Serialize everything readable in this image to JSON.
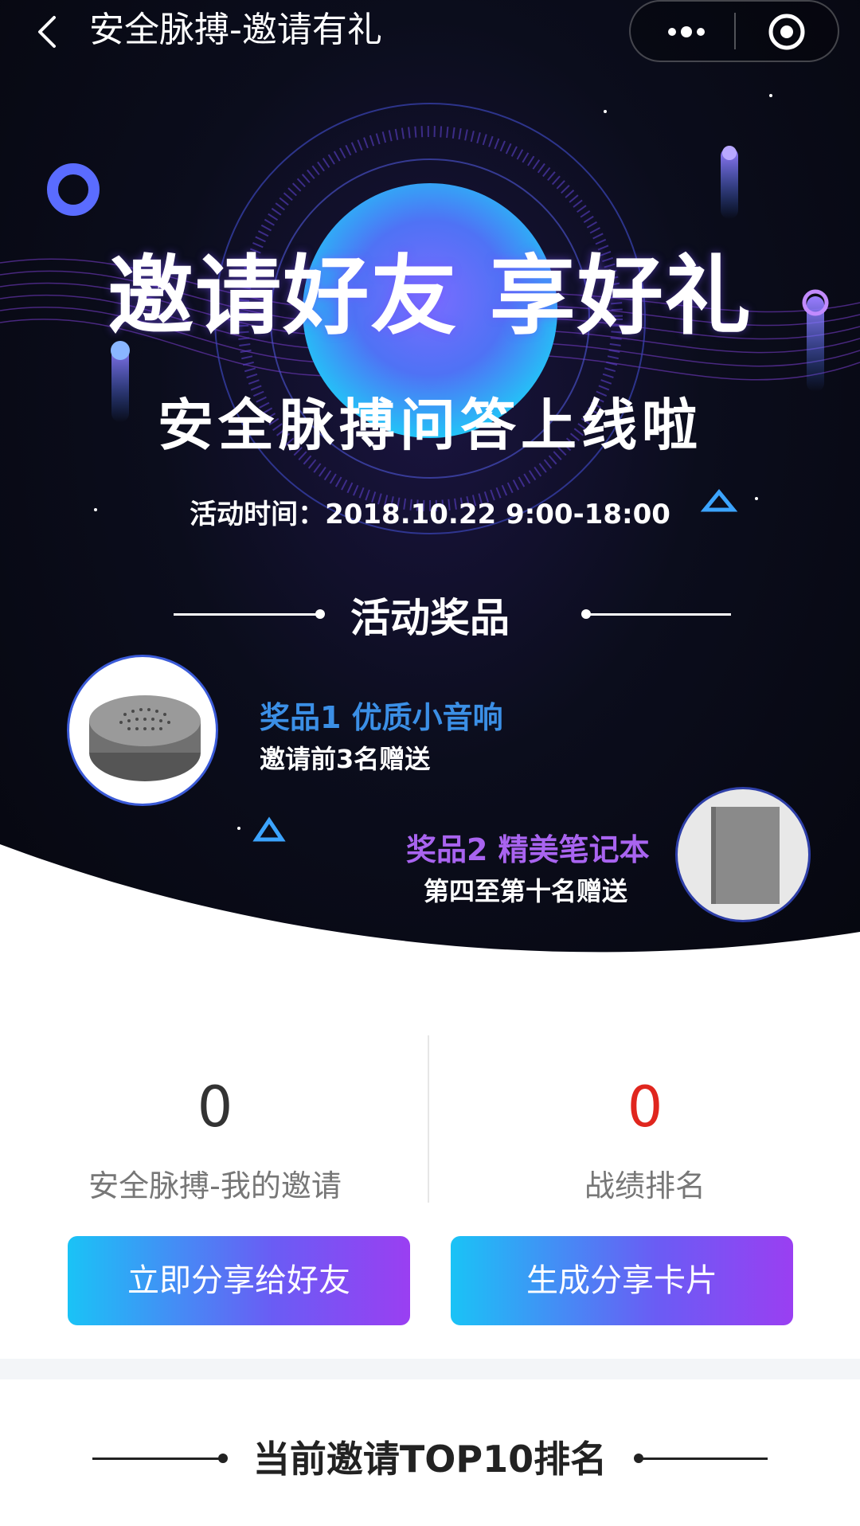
{
  "topbar": {
    "title": "安全脉搏-邀请有礼",
    "more_icon": "more-dots-icon",
    "close_icon": "target-close-icon"
  },
  "hero": {
    "headline": "邀请好友 享好礼",
    "subheadline": "安全脉搏问答上线啦",
    "event_time": "活动时间：2018.10.22 9:00-18:00",
    "prize_section_title": "活动奖品",
    "prizes": [
      {
        "name": "奖品1 优质小音响",
        "desc": "邀请前3名赠送",
        "color": "#3b8fe6",
        "icon": "speaker-image"
      },
      {
        "name": "奖品2 精美笔记本",
        "desc": "第四至第十名赠送",
        "color": "#a964f0",
        "icon": "notebook-image"
      }
    ]
  },
  "stats": {
    "my_invites_value": "0",
    "my_invites_label": "安全脉搏-我的邀请",
    "rank_value": "0",
    "rank_label": "战绩排名",
    "rank_color": "#e0261e"
  },
  "actions": {
    "share_friends": "立即分享给好友",
    "generate_card": "生成分享卡片"
  },
  "ranking": {
    "title": "当前邀请TOP10排名"
  }
}
